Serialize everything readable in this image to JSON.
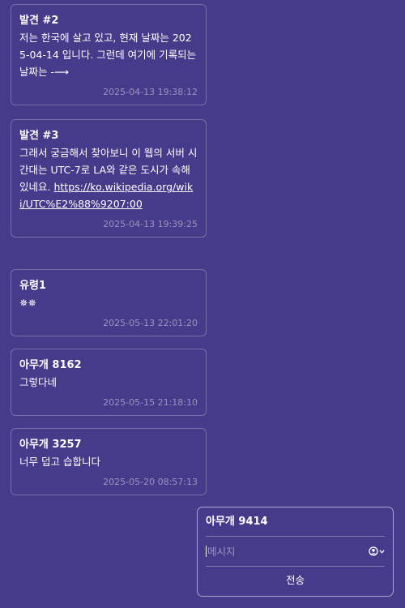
{
  "messages": [
    {
      "author": "발견 #2",
      "text": "저는 한국에 살고 있고, 현재 날짜는 2025-04-14 입니다. 그런데 여기에 기록되는 날짜는 -⟶",
      "link": "",
      "time": "2025-04-13 19:38:12"
    },
    {
      "author": "발견 #3",
      "text": "그래서 궁금해서 찾아보니 이 웹의 서버 시간대는 UTC-7로 LA와 같은 도시가 속해있네요.",
      "link": "https://ko.wikipedia.org/wiki/UTC%E2%88%9207:00",
      "time": "2025-04-13 19:39:25"
    },
    {
      "author": "유령1",
      "text": "✵✵",
      "link": "",
      "time": "2025-05-13 22:01:20"
    },
    {
      "author": "아무개 8162",
      "text": "그렇다네",
      "link": "",
      "time": "2025-05-15 21:18:10"
    },
    {
      "author": "아무개 3257",
      "text": "너무 덥고 습합니다",
      "link": "",
      "time": "2025-05-20 08:57:13"
    }
  ],
  "composer": {
    "name": "아무개 9414",
    "placeholder": "메시지",
    "emoji_icon": "emoji-icon",
    "send_label": "전송"
  }
}
